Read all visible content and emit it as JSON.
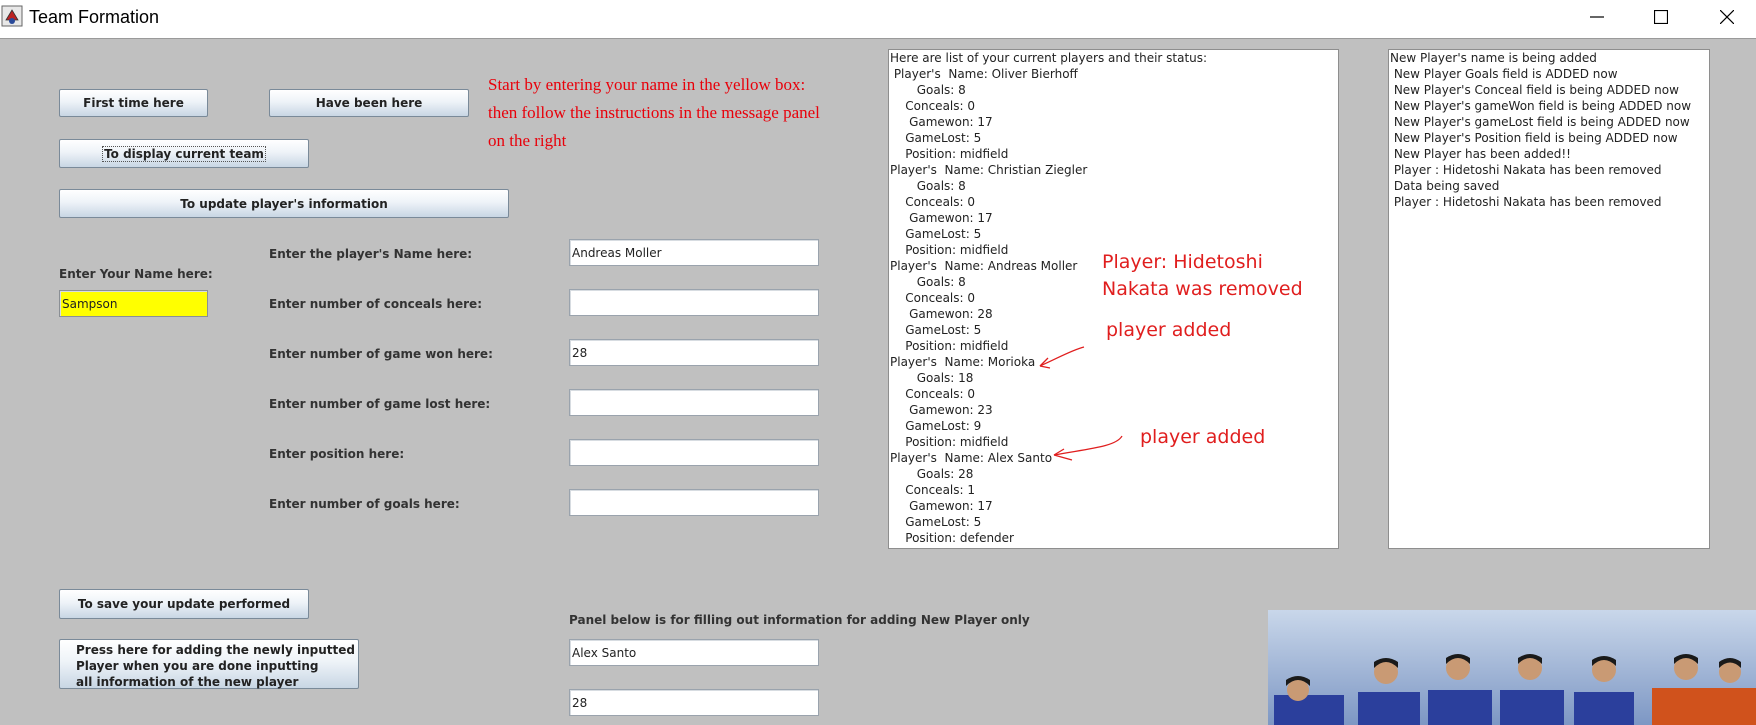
{
  "window": {
    "title": "Team Formation",
    "controls": [
      "minimize-icon",
      "maximize-icon",
      "close-icon"
    ]
  },
  "buttons": {
    "first_time": "First time here",
    "have_been": "Have been here",
    "display_team": "To display current team",
    "update_info": "To update player's information",
    "save_update": "To save your update performed",
    "add_player": "Press here for adding the newly inputted\nPlayer when you are done inputting\nall information of the new player"
  },
  "instruction": "Start by entering your name in the yellow box:\nthen follow the instructions in the message panel\non the right",
  "your_name": {
    "label": "Enter Your Name here:",
    "value": "Sampson"
  },
  "form": {
    "fields": [
      {
        "label": "Enter the player's Name here:",
        "value": "Andreas Moller"
      },
      {
        "label": "Enter number of conceals here:",
        "value": ""
      },
      {
        "label": "Enter number of game won here:",
        "value": "28"
      },
      {
        "label": "Enter number of game lost here:",
        "value": ""
      },
      {
        "label": "Enter position here:",
        "value": ""
      },
      {
        "label": "Enter number of goals here:",
        "value": ""
      }
    ]
  },
  "new_player": {
    "label": "Panel below is for filling out information for adding New Player only",
    "fields": [
      "Alex Santo",
      "28"
    ]
  },
  "players_panel": {
    "lines": [
      "Here are list of your current players and their status:",
      " Player's  Name: Oliver Bierhoff",
      "       Goals: 8",
      "    Conceals: 0",
      "     Gamewon: 17",
      "    GameLost: 5",
      "    Position: midfield",
      "Player's  Name: Christian Ziegler",
      "       Goals: 8",
      "    Conceals: 0",
      "     Gamewon: 17",
      "    GameLost: 5",
      "    Position: midfield",
      "Player's  Name: Andreas Moller",
      "       Goals: 8",
      "    Conceals: 0",
      "     Gamewon: 28",
      "    GameLost: 5",
      "    Position: midfield",
      "Player's  Name: Morioka",
      "       Goals: 18",
      "    Conceals: 0",
      "     Gamewon: 23",
      "    GameLost: 9",
      "    Position: midfield",
      "Player's  Name: Alex Santo",
      "       Goals: 28",
      "    Conceals: 1",
      "     Gamewon: 17",
      "    GameLost: 5",
      "    Position: defender"
    ]
  },
  "message_panel": {
    "lines": [
      "New Player's name is being added",
      " New Player Goals field is ADDED now",
      " New Player's Conceal field is being ADDED now",
      " New Player's gameWon field is being ADDED now",
      " New Player's gameLost field is being ADDED now",
      " New Player's Position field is being ADDED now",
      " New Player has been added!!",
      " Player : Hidetoshi Nakata has been removed",
      " Data being saved",
      " Player : Hidetoshi Nakata has been removed"
    ]
  },
  "annotations": {
    "removed": "Player: Hidetoshi\nNakata was removed",
    "added_1": "player added",
    "added_2": "player added"
  },
  "colors": {
    "background": "#c0c0c0",
    "name_field": "#ffff00",
    "instruction_text": "#e8000a",
    "annotation_text": "#e01e1e"
  }
}
